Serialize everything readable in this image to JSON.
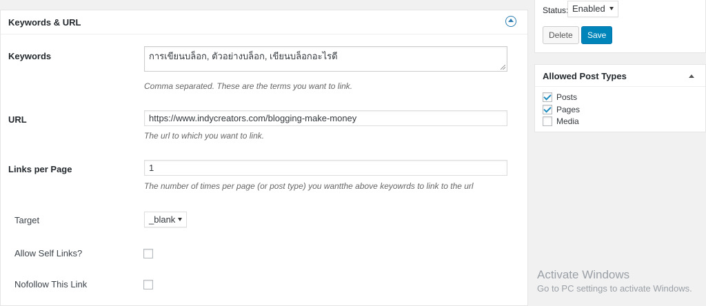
{
  "panel": {
    "title": "Keywords & URL"
  },
  "keywords": {
    "label": "Keywords",
    "value": "การเขียนบล็อก, ตัวอย่างบล็อก, เขียนบล็อกอะไรดี",
    "description": "Comma separated. These are the terms you want to link."
  },
  "url": {
    "label": "URL",
    "value": "https://www.indycreators.com/blogging-make-money",
    "description": "The url to which you want to link."
  },
  "links_per_page": {
    "label": "Links per Page",
    "value": "1",
    "description": "The number of times per page (or post type) you wantthe above keyowrds to link to the url"
  },
  "target": {
    "label": "Target",
    "selected": "_blank"
  },
  "self_links": {
    "label": "Allow Self Links?",
    "checked": false
  },
  "nofollow": {
    "label": "Nofollow This Link",
    "checked": false
  },
  "publish": {
    "status_label": "Status:",
    "status_value": "Enabled",
    "delete_label": "Delete",
    "save_label": "Save"
  },
  "post_types": {
    "title": "Allowed Post Types",
    "items": [
      {
        "label": "Posts",
        "checked": true
      },
      {
        "label": "Pages",
        "checked": true
      },
      {
        "label": "Media",
        "checked": false
      }
    ]
  },
  "watermark": {
    "title": "Activate Windows",
    "subtitle": "Go to PC settings to activate Windows."
  },
  "colors": {
    "accent": "#0085ba",
    "check": "#1e8cbe"
  }
}
